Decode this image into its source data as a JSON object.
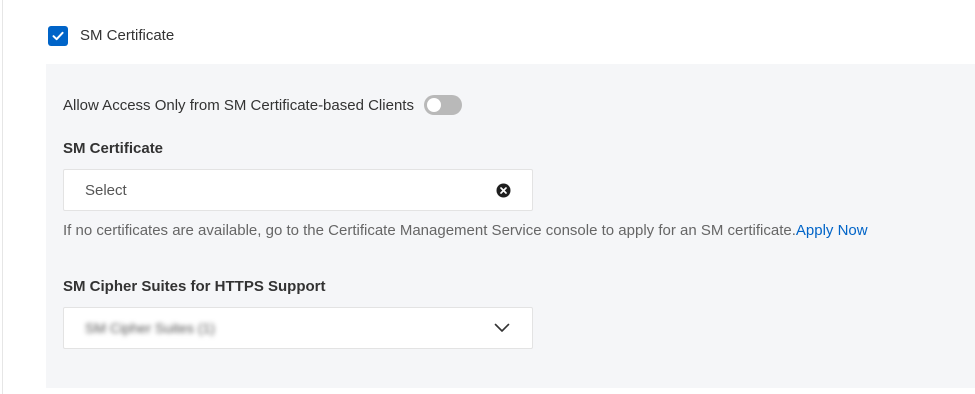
{
  "sm_certificate_toggle": {
    "label": "SM Certificate",
    "checked": true,
    "accent_color": "#0064c8"
  },
  "settings_panel": {
    "access_only": {
      "label": "Allow Access Only from SM Certificate-based Clients",
      "enabled": false
    },
    "certificate": {
      "title": "SM Certificate",
      "placeholder": "Select",
      "icon": "clear-icon",
      "hint": "If no certificates are available, go to the Certificate Management Service console to apply for an SM certificate.",
      "hint_link": "Apply Now"
    },
    "cipher_suites": {
      "title": "SM Cipher Suites for HTTPS Support",
      "value": "SM Cipher Suites (1)",
      "icon": "chevron-down-icon"
    }
  }
}
